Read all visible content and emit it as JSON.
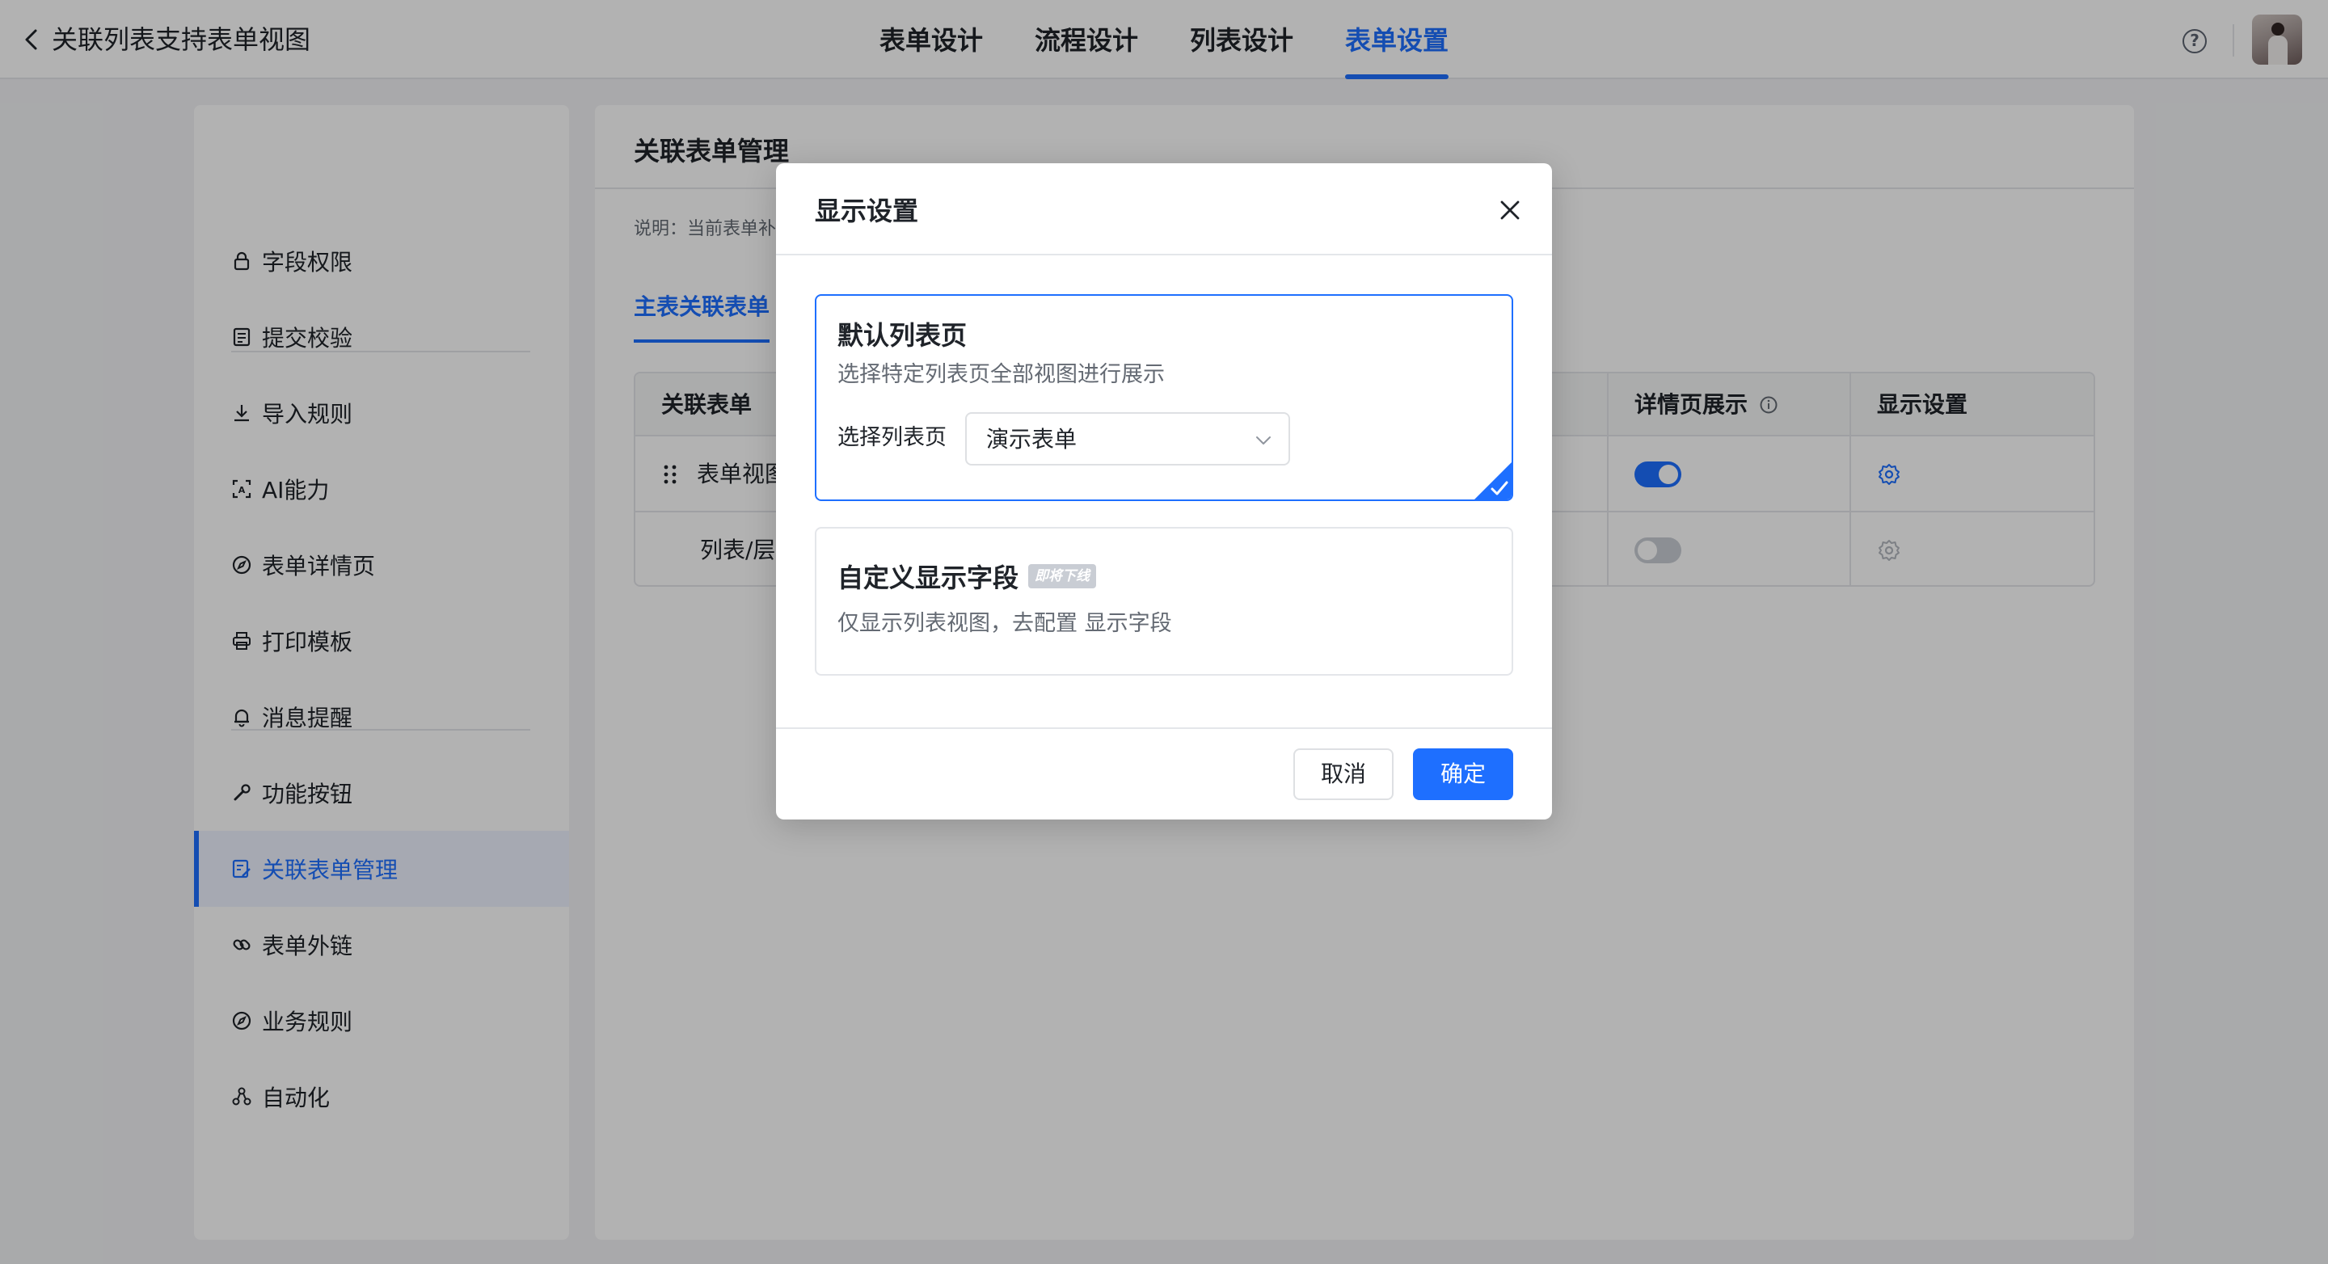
{
  "header": {
    "back_icon": "chevron-left-icon",
    "title": "关联列表支持表单视图",
    "tabs": [
      {
        "label": "表单设计",
        "active": false
      },
      {
        "label": "流程设计",
        "active": false
      },
      {
        "label": "列表设计",
        "active": false
      },
      {
        "label": "表单设置",
        "active": true
      }
    ],
    "help_glyph": "?",
    "accent_color": "#1e6fff"
  },
  "sidebar": {
    "items": [
      {
        "label": "字段权限",
        "icon": "lock-icon"
      },
      {
        "label": "提交校验",
        "icon": "checklist-icon"
      },
      {
        "label": "导入规则",
        "icon": "download-icon"
      },
      {
        "label": "AI能力",
        "icon": "ai-scan-icon"
      },
      {
        "label": "表单详情页",
        "icon": "compass-icon"
      },
      {
        "label": "打印模板",
        "icon": "printer-icon"
      },
      {
        "label": "消息提醒",
        "icon": "bell-icon"
      },
      {
        "label": "功能按钮",
        "icon": "wrench-icon"
      },
      {
        "label": "关联表单管理",
        "icon": "edit-form-icon",
        "active": true
      },
      {
        "label": "表单外链",
        "icon": "link-icon"
      },
      {
        "label": "业务规则",
        "icon": "compass-icon"
      },
      {
        "label": "自动化",
        "icon": "nodes-icon"
      }
    ]
  },
  "main": {
    "title": "关联表单管理",
    "description": "说明：当前表单补",
    "subtab": "主表关联表单",
    "table": {
      "headers": {
        "col1": "关联表单",
        "col_detail": "详情页展示",
        "col_display": "显示设置"
      },
      "rows": [
        {
          "name": "表单视图",
          "detail_visible": true
        },
        {
          "name": "列表/层",
          "detail_visible": false
        }
      ]
    }
  },
  "modal": {
    "title": "显示设置",
    "options": [
      {
        "title": "默认列表页",
        "description": "选择特定列表页全部视图进行展示",
        "select_label": "选择列表页",
        "select_value": "演示表单",
        "selected": true
      },
      {
        "title": "自定义显示字段",
        "badge": "即将下线",
        "description": "仅显示列表视图，去配置  显示字段",
        "selected": false
      }
    ],
    "cancel_label": "取消",
    "confirm_label": "确定"
  }
}
